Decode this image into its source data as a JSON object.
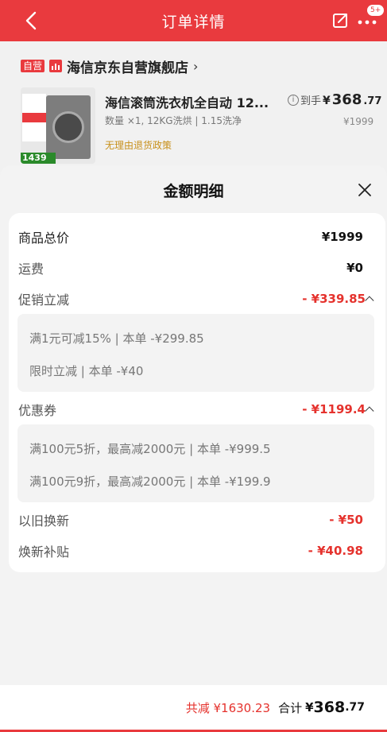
{
  "header": {
    "title": "订单详情",
    "badge": "5+",
    "accent_color": "#e93a3e"
  },
  "order": {
    "store_tag": "自营",
    "store_name": "海信京东自营旗舰店",
    "store_chevron": "›",
    "product_title": "海信滚筒洗衣机全自动 12...",
    "product_spec": "数量 ×1, 12KG洗烘 | 1.15洗净",
    "product_policy": "无理由退货政策",
    "image_price": "1439",
    "final_price_label": "到手",
    "final_price_currency": "¥",
    "final_price_main": "368",
    "final_price_decimal": ".77",
    "original_price": "¥1999"
  },
  "modal": {
    "title": "金额明细",
    "rows": {
      "goods_total": {
        "label": "商品总价",
        "value": "¥1999"
      },
      "shipping": {
        "label": "运费",
        "value": "¥0"
      },
      "promo": {
        "label": "促销立减",
        "value": "- ¥339.85"
      },
      "coupon": {
        "label": "优惠券",
        "value": "- ¥1199.4"
      },
      "tradein": {
        "label": "以旧换新",
        "value": "- ¥50"
      },
      "subsidy": {
        "label": "焕新补贴",
        "value": "- ¥40.98"
      }
    },
    "promo_details": [
      "满1元可减15% | 本单 -¥299.85",
      "限时立减 | 本单 -¥40"
    ],
    "coupon_details": [
      "满100元5折，最高减2000元 | 本单 -¥999.5",
      "满100元9折，最高减2000元 | 本单 -¥199.9"
    ],
    "discount_color": "#e5322d"
  },
  "footer": {
    "total_saved": "共减 ¥1630.23",
    "total_label": "合计",
    "total_currency": "¥",
    "total_main": "368",
    "total_decimal": ".77"
  }
}
